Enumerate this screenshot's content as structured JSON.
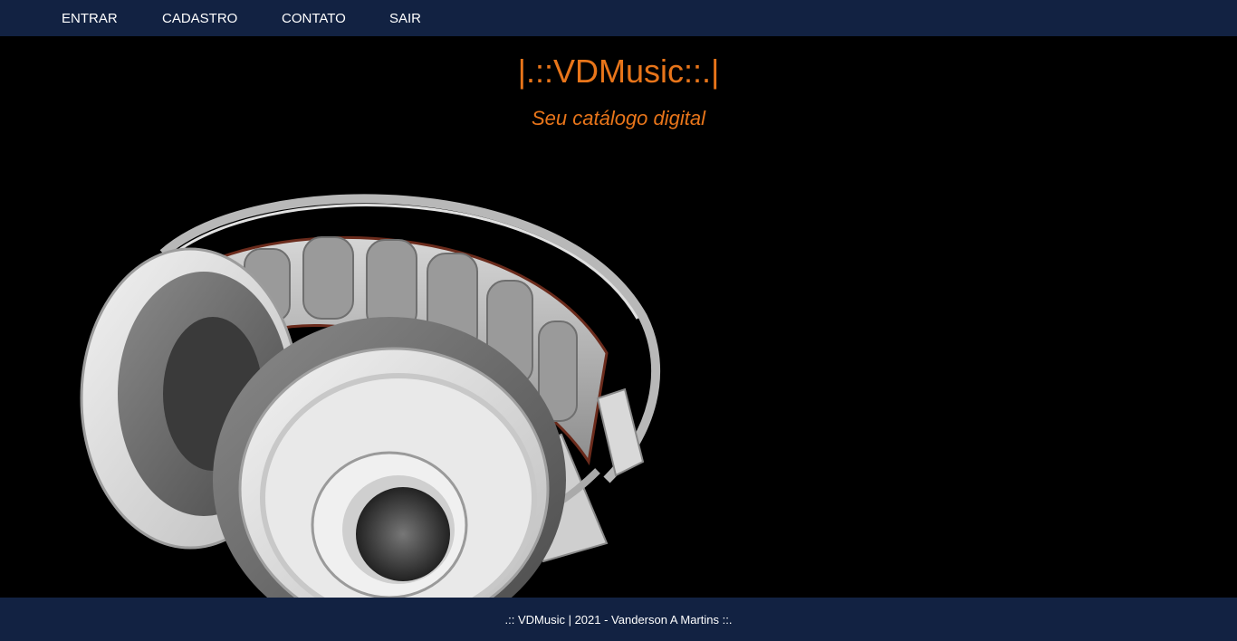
{
  "nav": {
    "items": [
      {
        "label": "ENTRAR"
      },
      {
        "label": "CADASTRO"
      },
      {
        "label": "CONTATO"
      },
      {
        "label": "SAIR"
      }
    ]
  },
  "hero": {
    "title": "|.::VDMusic::.|",
    "subtitle": "Seu catálogo digital",
    "image_icon": "headphones-icon"
  },
  "footer": {
    "text": ".:: VDMusic | 2021 - Vanderson A Martins ::."
  },
  "colors": {
    "nav_bg": "#122242",
    "accent": "#e8751a",
    "background": "#000000"
  }
}
